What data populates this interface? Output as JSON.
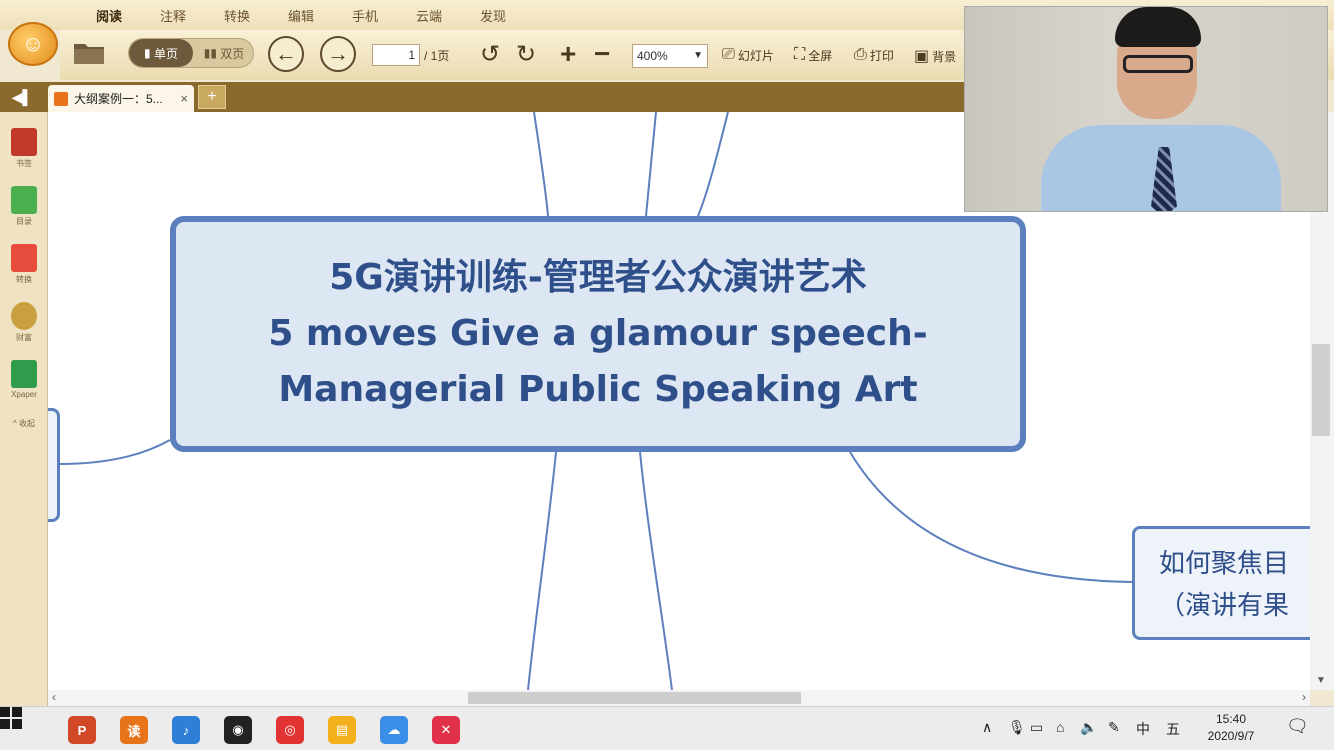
{
  "menu": {
    "tabs": [
      "阅读",
      "注释",
      "转换",
      "编辑",
      "手机",
      "云端",
      "发现"
    ],
    "active_index": 0
  },
  "toolbar": {
    "single_page": "单页",
    "double_page": "双页",
    "page_current": "1",
    "page_total": "/ 1页",
    "zoom": "400%",
    "slideshow": "幻灯片",
    "fullscreen": "全屏",
    "print": "打印",
    "background": "背景"
  },
  "tabbar": {
    "doc_tab_title": "大纲案例一：5...",
    "close_glyph": "×",
    "new_tab_glyph": "+"
  },
  "sidebar": {
    "items": [
      {
        "label": "书签",
        "icon": "bookmark-icon",
        "color": "#c0392b"
      },
      {
        "label": "目录",
        "icon": "toc-icon",
        "color": "#4caf50"
      },
      {
        "label": "转换",
        "icon": "convert-icon",
        "color": "#e74c3c"
      },
      {
        "label": "财富",
        "icon": "wealth-icon",
        "color": "#c9a040"
      },
      {
        "label": "Xpaper",
        "icon": "xpaper-icon",
        "color": "#2e9c4a"
      },
      {
        "label": "^ 收起",
        "icon": "collapse-icon",
        "color": "#7a6644"
      }
    ]
  },
  "mindmap": {
    "central": {
      "line1": "5G演讲训练-管理者公众演讲艺术",
      "line2": "5 moves  Give a  glamour speech-",
      "line3": "Managerial Public Speaking Art"
    },
    "right_topic": {
      "line1": "如何聚焦目",
      "line2": "（演讲有果"
    }
  },
  "taskbar": {
    "apps": [
      {
        "name": "powerpoint-icon",
        "color": "#d24726",
        "glyph": "P"
      },
      {
        "name": "reader-icon",
        "color": "#e8741a",
        "glyph": "读"
      },
      {
        "name": "music-icon",
        "color": "#2f7fd8",
        "glyph": "♪"
      },
      {
        "name": "camera-icon",
        "color": "#222222",
        "glyph": "◉"
      },
      {
        "name": "netease-music-icon",
        "color": "#e23333",
        "glyph": "◎"
      },
      {
        "name": "files-icon",
        "color": "#f3b01c",
        "glyph": "▤"
      },
      {
        "name": "baidu-pan-icon",
        "color": "#3b8ee8",
        "glyph": "☁"
      },
      {
        "name": "xmind-icon",
        "color": "#e0314b",
        "glyph": "✕"
      }
    ],
    "ime_lang": "中",
    "ime_mode": "五",
    "time": "15:40",
    "date": "2020/9/7"
  }
}
